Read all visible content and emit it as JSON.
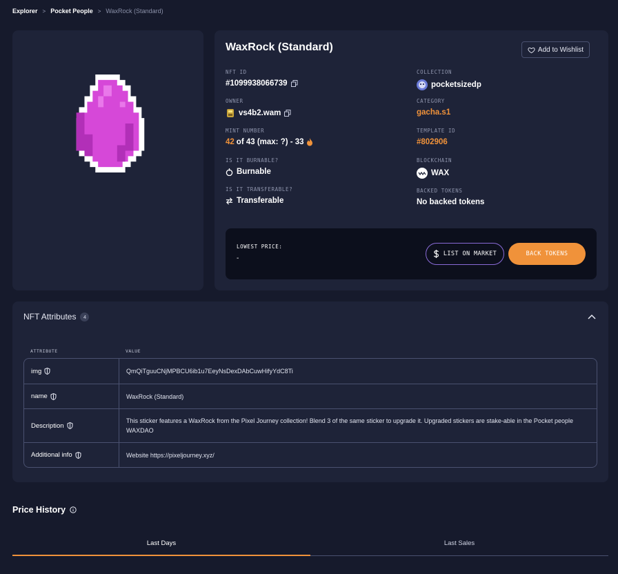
{
  "breadcrumb": {
    "home": "Explorer",
    "collection": "Pocket People",
    "current": "WaxRock (Standard)",
    "sep": ">"
  },
  "nft": {
    "title": "WaxRock (Standard)",
    "wishlist_label": "Add to Wishlist",
    "fields": {
      "nft_id": {
        "label": "NFT ID",
        "value": "#1099938066739"
      },
      "collection": {
        "label": "COLLECTION",
        "value": "pocketsizedp"
      },
      "owner": {
        "label": "OWNER",
        "value": "vs4b2.wam"
      },
      "category": {
        "label": "CATEGORY",
        "value": "gacha.s1"
      },
      "mint": {
        "label": "MINT NUMBER",
        "number": "42",
        "rest": "of 43 (max: ?) - 33"
      },
      "template": {
        "label": "TEMPLATE ID",
        "value": "#802906"
      },
      "burnable": {
        "label": "IS IT BURNABLE?",
        "value": "Burnable"
      },
      "blockchain": {
        "label": "BLOCKCHAIN",
        "value": "WAX"
      },
      "transferable": {
        "label": "IS IT TRANSFERABLE?",
        "value": "Transferable"
      },
      "backed": {
        "label": "BACKED TOKENS",
        "value": "No backed tokens"
      }
    }
  },
  "market": {
    "lowest_label": "LOWEST PRICE:",
    "lowest_value": "-",
    "list_label": "LIST ON MARKET",
    "back_label": "BACK TOKENS"
  },
  "attributes": {
    "title": "NFT Attributes",
    "count": "4",
    "col_attribute": "ATTRIBUTE",
    "col_value": "VALUE",
    "rows": [
      {
        "key": "img",
        "value": "QmQiTguuCNjMPBCU6ib1u7EeyNsDexDAbCuwHifyYdC8Ti"
      },
      {
        "key": "name",
        "value": "WaxRock (Standard)"
      },
      {
        "key": "Description",
        "value": "This sticker features a WaxRock from the Pixel Journey collection! Blend 3 of the same sticker to upgrade it. Upgraded stickers are stake-able in the Pocket people WAXDAO"
      },
      {
        "key": "Additional info",
        "value": "Website https://pixeljourney.xyz/"
      }
    ]
  },
  "price_history": {
    "title": "Price History",
    "tab_days": "Last Days",
    "tab_sales": "Last Sales"
  },
  "colors": {
    "accent": "#f0923a",
    "gem": "#d648d8",
    "card": "#1e2338",
    "background": "#161a2c"
  },
  "icons": [
    "copy-icon",
    "heart-icon",
    "fire-icon",
    "burn-icon",
    "transfer-icon",
    "wax-icon",
    "dollar-icon",
    "shield-icon",
    "info-icon",
    "chevron-up-icon"
  ]
}
